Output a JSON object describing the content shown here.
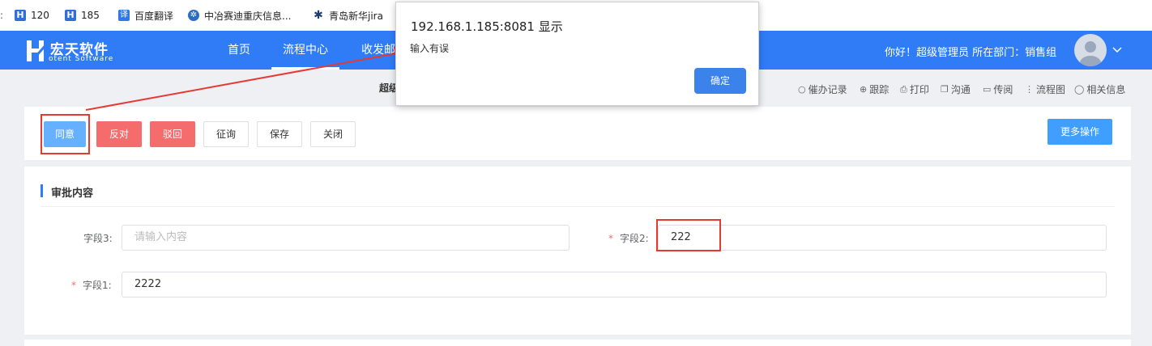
{
  "bookmarks": [
    {
      "label": "120",
      "icon": "h-logo-icon"
    },
    {
      "label": "185",
      "icon": "h-logo-icon"
    },
    {
      "label": "百度翻译",
      "icon": "translate-icon"
    },
    {
      "label": "中冶赛迪重庆信息...",
      "icon": "gear-icon"
    },
    {
      "label": "青岛新华jira",
      "icon": "jira-icon"
    }
  ],
  "header": {
    "logo_cn": "宏天软件",
    "logo_en": "otent Software",
    "nav": [
      "首页",
      "流程中心",
      "收发邮"
    ],
    "greeting": "你好！超级管理员 所在部门：销售组"
  },
  "breadcrumb": {
    "text": "超级"
  },
  "tools": [
    "催办记录",
    "跟踪",
    "打印",
    "沟通",
    "传阅",
    "流程图",
    "相关信息"
  ],
  "buttons": {
    "agree": "同意",
    "oppose": "反对",
    "reject": "驳回",
    "consult": "征询",
    "save": "保存",
    "close": "关闭",
    "more": "更多操作"
  },
  "form": {
    "section_title": "审批内容",
    "field3": {
      "label": "字段3:",
      "value": "",
      "placeholder": "请输入内容"
    },
    "field2": {
      "label": "字段2:",
      "value": "222",
      "required": "*"
    },
    "field1": {
      "label": "字段1:",
      "value": "2222",
      "required": "*"
    }
  },
  "dialog": {
    "title": "192.168.1.185:8081 显示",
    "message": "输入有误",
    "ok": "确定"
  },
  "colors": {
    "primary": "#2f7cf6",
    "danger": "#f56c6c",
    "annotation": "#e53935"
  }
}
